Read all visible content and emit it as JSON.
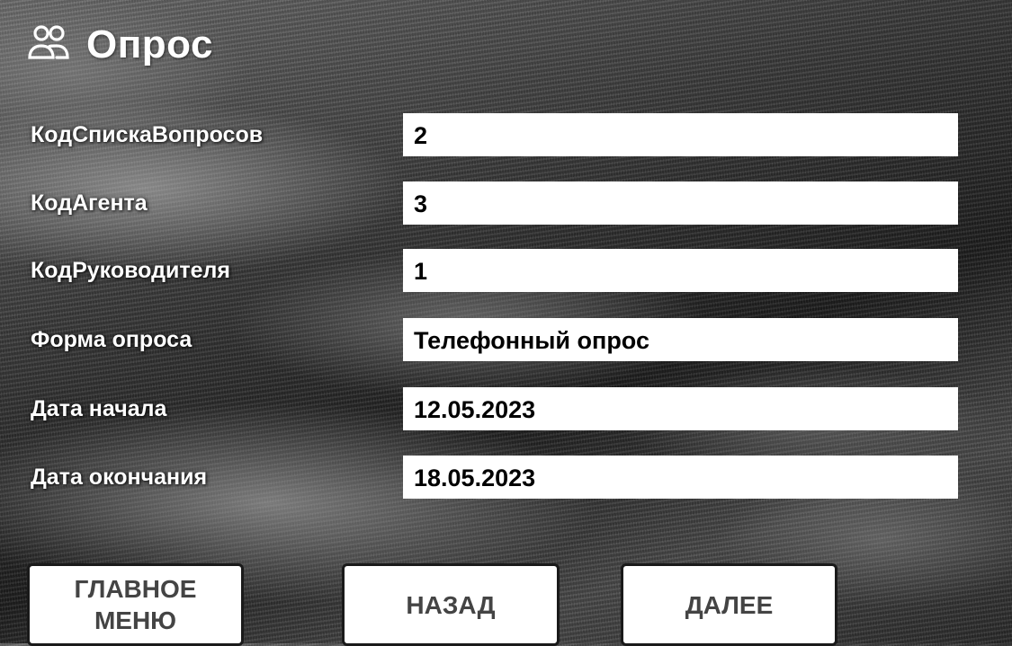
{
  "header": {
    "title": "Опрос",
    "icon": "users-icon"
  },
  "form": {
    "fields": [
      {
        "label": "КодСпискаВопросов",
        "value": "2"
      },
      {
        "label": "КодАгента",
        "value": "3"
      },
      {
        "label": "КодРуководителя",
        "value": "1"
      },
      {
        "label": "Форма опроса",
        "value": "Телефонный опрос"
      },
      {
        "label": "Дата начала",
        "value": "12.05.2023"
      },
      {
        "label": "Дата окончания",
        "value": "18.05.2023"
      }
    ]
  },
  "buttons": {
    "main_menu_line1": "ГЛАВНОЕ",
    "main_menu_line2": "МЕНЮ",
    "back": "НАЗАД",
    "next": "ДАЛЕЕ"
  }
}
